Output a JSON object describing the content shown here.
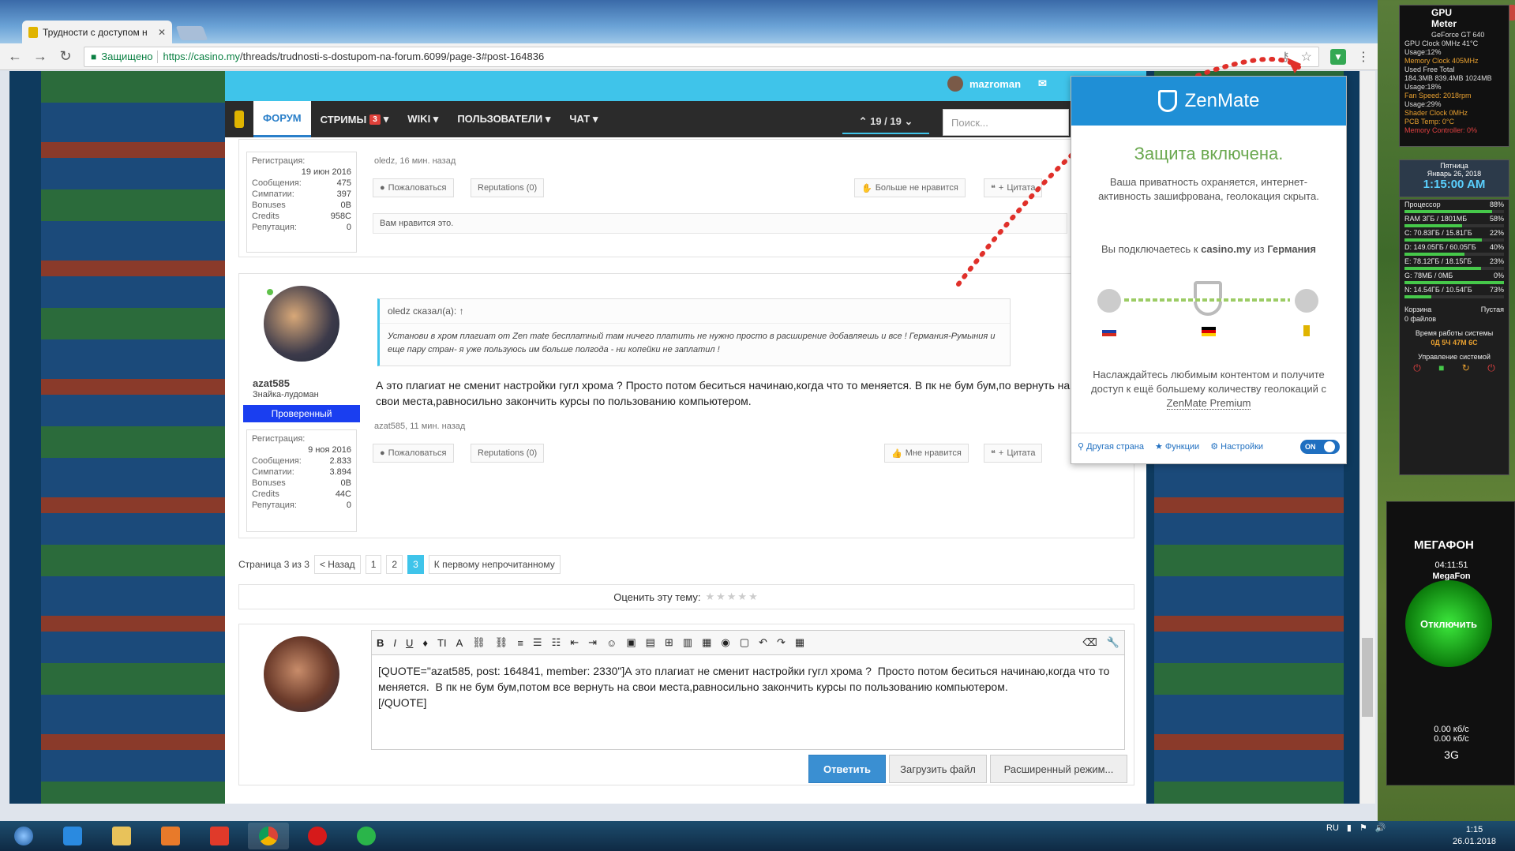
{
  "browser": {
    "tab_title": "Трудности с доступом н",
    "secure_label": "Защищено",
    "url_host": "https://casino.my",
    "url_path": "/threads/trudnosti-s-dostupom-na-forum.6099/page-3#post-164836",
    "window_controls": [
      "▫",
      "–",
      "▢",
      "✕"
    ]
  },
  "forum": {
    "username": "mazroman",
    "nav": [
      {
        "label": "ФОРУМ",
        "active": true
      },
      {
        "label": "СТРИМЫ",
        "badge": "3"
      },
      {
        "label": "WIKI ▾"
      },
      {
        "label": "ПОЛЬЗОВАТЕЛИ ▾"
      },
      {
        "label": "ЧАТ ▾"
      }
    ],
    "pager": "⌃ 19 / 19 ⌄",
    "search_placeholder": "Поиск...",
    "post1": {
      "stats": [
        [
          "Регистрация:",
          ""
        ],
        [
          "",
          "19 июн 2016"
        ],
        [
          "Сообщения:",
          "475"
        ],
        [
          "Симпатии:",
          "397"
        ],
        [
          "Bonuses",
          "0В"
        ],
        [
          "Credits",
          "958С"
        ],
        [
          "Репутация:",
          "0"
        ]
      ],
      "meta": "oledz, 16 мин. назад",
      "report": "Пожаловаться",
      "reputations": "Reputations (0)",
      "unlike": "Больше не нравится",
      "quote_btn": "Цитата",
      "likes_text": "Вам нравится это."
    },
    "post2": {
      "user": "azat585",
      "title": "Знайка-лудоман",
      "badge": "Проверенный",
      "stats": [
        [
          "Регистрация:",
          ""
        ],
        [
          "",
          "9 ноя 2016"
        ],
        [
          "Сообщения:",
          "2.833"
        ],
        [
          "Симпатии:",
          "3.894"
        ],
        [
          "Bonuses",
          "0В"
        ],
        [
          "Credits",
          "44С"
        ],
        [
          "Репутация:",
          "0"
        ]
      ],
      "quote_head": "oledz сказал(а): ↑",
      "quote_body": "Установи в хром плагиат от Zen mate бесплатный там ничего платить не нужно просто в расширение добавляешь и все ! Германия-Румыния и еще пару стран- я уже пользуюсь им больше полгода - ни копейки не заплатил !",
      "text": "А это плагиат не сменит настройки гугл хрома ? Просто потом беситься начинаю,когда что то меняется. В пк не бум бум,по вернуть на свои места,равносильно закончить курсы по пользованию компьютером.",
      "meta": "azat585, 11 мин. назад",
      "report": "Пожаловаться",
      "reputations": "Reputations (0)",
      "like": "Мне нравится",
      "quote_btn": "Цитата"
    },
    "pagination": {
      "label": "Страница 3 из 3",
      "prev": "< Назад",
      "pages": [
        "1",
        "2",
        "3"
      ],
      "current": "3",
      "first_unread": "К первому непрочитанному"
    },
    "rate_label": "Оценить эту тему:",
    "editor": {
      "tools": [
        "B",
        "I",
        "U",
        "♦",
        "TI",
        "A",
        "⛓",
        "⛓",
        "≡",
        "☰",
        "☷",
        "⇤",
        "⇥",
        "☺",
        "▣",
        "▤",
        "⊞",
        "▥",
        "▦",
        "◉",
        "▢",
        "↶",
        "↷",
        "▦"
      ],
      "text": "[QUOTE=\"azat585, post: 164841, member: 2330\"]А это плагиат не сменит настройки гугл хрома ?  Просто потом беситься начинаю,когда что то меняется.  В пк не бум бум,потом все вернуть на свои места,равносильно закончить курсы по пользованию компьютером.\n[/QUOTE]",
      "reply": "Ответить",
      "upload": "Загрузить файл",
      "advanced": "Расширенный режим..."
    }
  },
  "zenmate": {
    "brand": "ZenMate",
    "status": "Защита включена.",
    "privacy": "Ваша приватность охраняется, интернет-активность зашифрована, геолокация скрыта.",
    "connect_prefix": "Вы подключаетесь к",
    "connect_host": "casino.my",
    "connect_mid": "из",
    "connect_country": "Германия",
    "promo": "Наслаждайтесь любимым контентом и получите доступ к ещё большему количеству геолокаций с",
    "premium": "ZenMate Premium",
    "footer": [
      "Другая страна",
      "Функции",
      "Настройки"
    ],
    "toggle": "ON"
  },
  "gadgets": {
    "gpu": {
      "title": "GPU Meter",
      "card": "GeForce GT 640",
      "lines": [
        "GPU Clock 0MHz      41°C",
        "Usage:12%",
        "Memory Clock 405MHz",
        "Used   Free   Total",
        "184.3MB 839.4MB 1024MB",
        "Usage:18%",
        "Fan Speed: 2018rpm",
        "Usage:29%",
        "Shader Clock 0MHz",
        "PCB Temp: 0°C",
        "Memory Controller: 0%"
      ]
    },
    "calendar": {
      "day": "Пятница",
      "date": "Январь 26, 2018",
      "time": "1:15:00 AM"
    },
    "sysmon": [
      {
        "label": "Процессор",
        "value": "88%",
        "pct": 88
      },
      {
        "label": "RAM 3ГБ / 1801МБ",
        "value": "58%",
        "pct": 58
      },
      {
        "label": "C: 70.83ГБ / 15.81ГБ",
        "value": "22%",
        "pct": 78
      },
      {
        "label": "D: 149.05ГБ / 60.05ГБ",
        "value": "40%",
        "pct": 60
      },
      {
        "label": "E: 78.12ГБ / 18.15ГБ",
        "value": "23%",
        "pct": 77
      },
      {
        "label": "G: 78МБ / 0МБ",
        "value": "0%",
        "pct": 100
      },
      {
        "label": "N: 14.54ГБ / 10.54ГБ",
        "value": "73%",
        "pct": 27
      }
    ],
    "trash": {
      "label": "Корзина",
      "state": "Пустая",
      "files": "0 файлов"
    },
    "uptime_label": "Время работы системы",
    "uptime": "0Д 5Ч 47М 6С",
    "control_label": "Управление системой",
    "megafon": {
      "brand": "МЕГАФОН",
      "time": "04:11:51",
      "name": "MegaFon",
      "button": "Отключить",
      "speed1": "0.00 кб/с",
      "speed2": "0.00 кб/с",
      "net": "3G"
    }
  },
  "taskbar": {
    "lang": "RU",
    "time": "1:15",
    "date": "26.01.2018"
  }
}
